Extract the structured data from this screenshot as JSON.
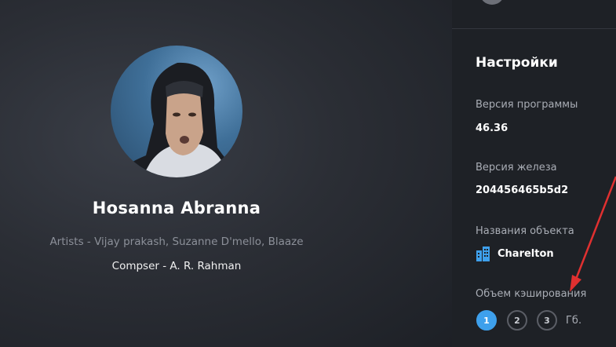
{
  "player": {
    "title": "Hosanna Abranna",
    "artists": "Artists - Vijay prakash, Suzanne D'mello, Blaaze",
    "composer": "Compser - A. R. Rahman"
  },
  "settings": {
    "title": "Настройки",
    "software_version_label": "Версия программы",
    "software_version_value": "46.36",
    "hardware_version_label": "Версия железа",
    "hardware_version_value": "204456465b5d2",
    "object_name_label": "Названия объекта",
    "object_name_value": "Charelton",
    "object_icon": "building-icon",
    "cache_label": "Объем кэширования",
    "cache_options": [
      "1",
      "2",
      "3"
    ],
    "cache_selected": "1",
    "cache_unit": "Гб."
  },
  "colors": {
    "accent": "#3ea0ec",
    "annotation_arrow": "#e03030"
  }
}
